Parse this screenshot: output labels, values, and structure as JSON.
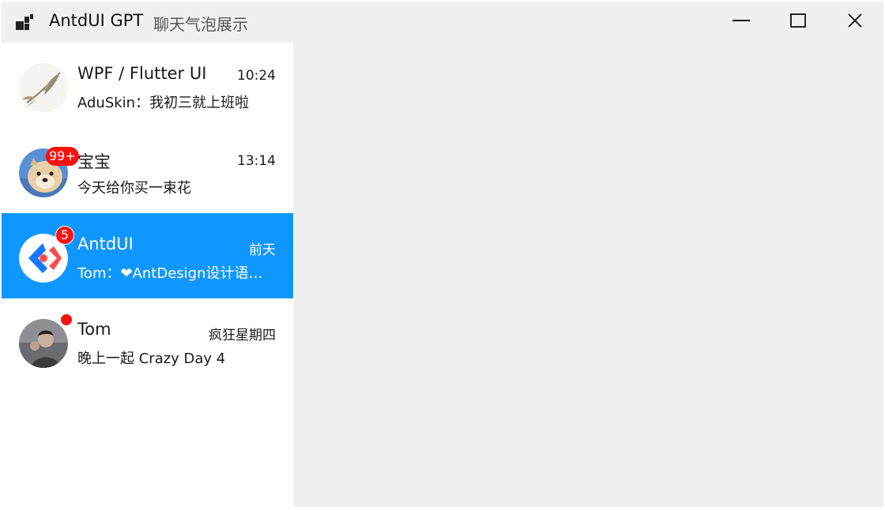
{
  "window": {
    "title": "AntdUI GPT",
    "subtitle": "聊天气泡展示"
  },
  "icons": {
    "app": "app-logo-icon",
    "minimize": "minimize-icon",
    "maximize": "maximize-icon",
    "close": "close-icon"
  },
  "conversations": [
    {
      "name": "WPF / Flutter UI",
      "time": "10:24",
      "message": "AduSkin：我初三就上班啦",
      "badge": "",
      "avatar": "feather-avatar"
    },
    {
      "name": "宝宝",
      "time": "13:14",
      "message": "今天给你买一束花",
      "badge": "99+",
      "avatar": "dog-avatar"
    },
    {
      "name": "AntdUI",
      "time": "前天",
      "message": "Tom：❤AntDesign设计语言的Winform界面库",
      "badge": "5",
      "avatar": "antd-logo-avatar",
      "selected": true
    },
    {
      "name": "Tom",
      "time": "疯狂星期四",
      "message": "晚上一起 Crazy Day 4",
      "badge": "",
      "dot": true,
      "avatar": "person-avatar"
    }
  ],
  "colors": {
    "selected": "#1097ff",
    "badge": "#ff1010",
    "background": "#f0f0f0"
  }
}
